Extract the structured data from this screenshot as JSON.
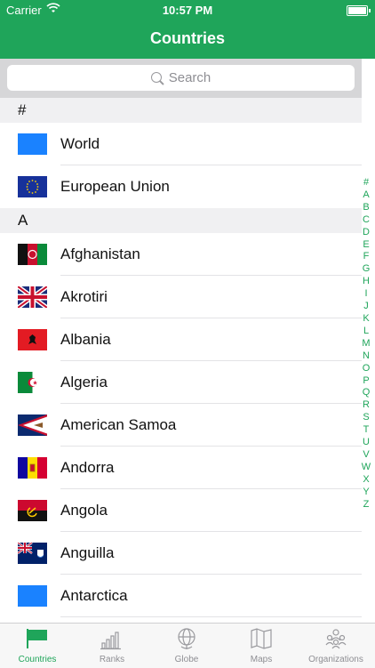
{
  "status_bar": {
    "carrier": "Carrier",
    "time": "10:57 PM"
  },
  "nav": {
    "title": "Countries"
  },
  "search": {
    "placeholder": "Search"
  },
  "sections": [
    {
      "header": "#",
      "rows": [
        {
          "name": "World",
          "flag": "blue-flag"
        },
        {
          "name": "European Union",
          "flag": "eu-flag"
        }
      ]
    },
    {
      "header": "A",
      "rows": [
        {
          "name": "Afghanistan",
          "flag": "afghanistan-flag"
        },
        {
          "name": "Akrotiri",
          "flag": "uk-flag"
        },
        {
          "name": "Albania",
          "flag": "albania-flag"
        },
        {
          "name": "Algeria",
          "flag": "algeria-flag"
        },
        {
          "name": "American Samoa",
          "flag": "american-samoa-flag"
        },
        {
          "name": "Andorra",
          "flag": "andorra-flag"
        },
        {
          "name": "Angola",
          "flag": "angola-flag"
        },
        {
          "name": "Anguilla",
          "flag": "anguilla-flag"
        },
        {
          "name": "Antarctica",
          "flag": "blue-flag"
        }
      ]
    }
  ],
  "index_letters": [
    "#",
    "A",
    "B",
    "C",
    "D",
    "E",
    "F",
    "G",
    "H",
    "I",
    "J",
    "K",
    "L",
    "M",
    "N",
    "O",
    "P",
    "Q",
    "R",
    "S",
    "T",
    "U",
    "V",
    "W",
    "X",
    "Y",
    "Z"
  ],
  "tabs": [
    {
      "label": "Countries",
      "icon": "flag-icon",
      "active": true
    },
    {
      "label": "Ranks",
      "icon": "bar-chart-icon",
      "active": false
    },
    {
      "label": "Globe",
      "icon": "globe-icon",
      "active": false
    },
    {
      "label": "Maps",
      "icon": "map-icon",
      "active": false
    },
    {
      "label": "Organizations",
      "icon": "people-icon",
      "active": false
    }
  ],
  "colors": {
    "accent": "#1fa55a",
    "separator": "#e3e3e6",
    "section_bg": "#f0f0f2"
  }
}
